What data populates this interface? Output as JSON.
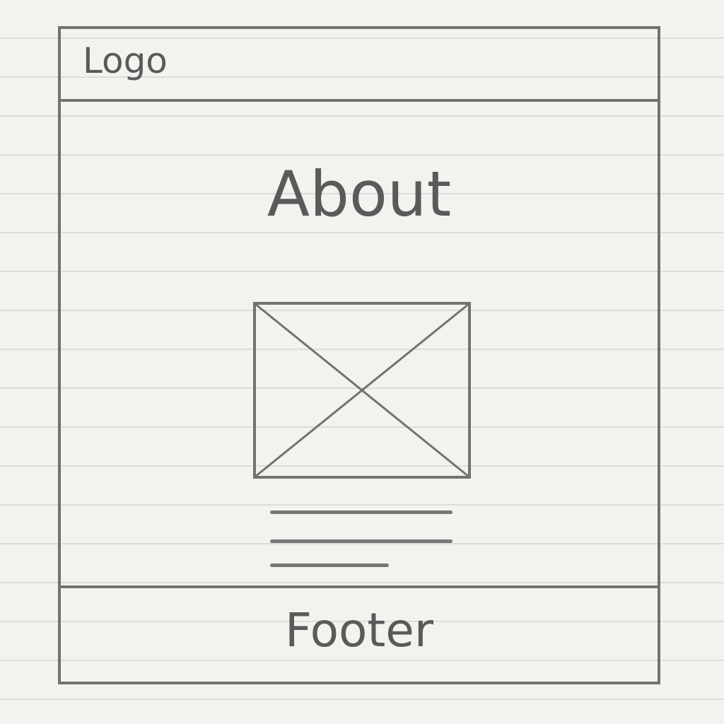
{
  "header": {
    "logo_text": "Logo"
  },
  "main": {
    "title": "About",
    "image_placeholder": "image-placeholder-icon"
  },
  "footer": {
    "label": "Footer"
  },
  "colors": {
    "paper": "#f4f2ee",
    "ruled_line": "#dcdcdc",
    "pencil": "#727272",
    "text": "#5a5a5a"
  }
}
